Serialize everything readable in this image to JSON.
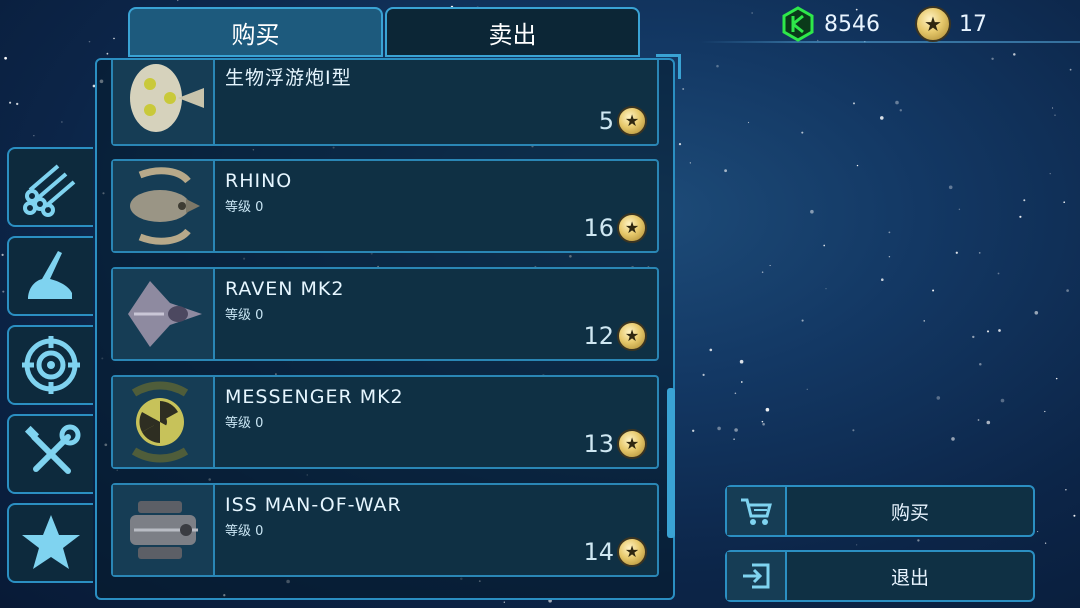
{
  "tabs": [
    {
      "label": "购买",
      "active": true
    },
    {
      "label": "卖出",
      "active": false
    }
  ],
  "currency": {
    "crystals": "8546",
    "crystal_icon": "green-crystal-icon",
    "stars": "17",
    "star_icon": "star-coin-icon"
  },
  "categories": [
    {
      "name": "missiles",
      "icon": "missile-tubes-icon"
    },
    {
      "name": "hull",
      "icon": "ship-hull-icon"
    },
    {
      "name": "targeting",
      "icon": "crosshair-icon"
    },
    {
      "name": "tools",
      "icon": "wrench-screwdriver-icon"
    },
    {
      "name": "favorites",
      "icon": "star-icon"
    }
  ],
  "items": [
    {
      "name": "生物浮游炮I型",
      "level": "",
      "price": "5",
      "thumb": "bio-drone-icon"
    },
    {
      "name": "RHINO",
      "level": "等级 0",
      "price": "16",
      "thumb": "rhino-ship-icon"
    },
    {
      "name": "RAVEN MK2",
      "level": "等级 0",
      "price": "12",
      "thumb": "raven-ship-icon"
    },
    {
      "name": "MESSENGER MK2",
      "level": "等级 0",
      "price": "13",
      "thumb": "messenger-ship-icon"
    },
    {
      "name": "ISS MAN-OF-WAR",
      "level": "等级 0",
      "price": "14",
      "thumb": "man-of-war-ship-icon"
    }
  ],
  "actions": {
    "buy": {
      "label": "购买",
      "icon": "cart-icon"
    },
    "exit": {
      "label": "退出",
      "icon": "exit-icon"
    }
  },
  "colors": {
    "accent": "#3aa3d4",
    "panel": "#0f3044",
    "crystal": "#2ee84a",
    "gold": "#e7c96c"
  }
}
